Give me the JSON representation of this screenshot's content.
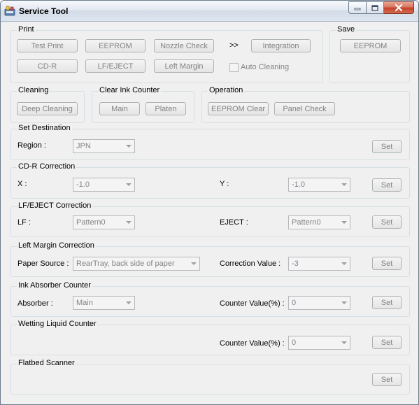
{
  "window": {
    "title": "Service Tool"
  },
  "print": {
    "label": "Print",
    "test_print": "Test Print",
    "eeprom": "EEPROM",
    "nozzle_check": "Nozzle Check",
    "more": ">>",
    "integration": "Integration",
    "cdr": "CD-R",
    "lf_eject": "LF/EJECT",
    "left_margin": "Left Margin",
    "auto_cleaning": "Auto Cleaning"
  },
  "save": {
    "label": "Save",
    "eeprom": "EEPROM"
  },
  "cleaning": {
    "label": "Cleaning",
    "deep": "Deep Cleaning"
  },
  "clear_ink": {
    "label": "Clear Ink Counter",
    "main": "Main",
    "platen": "Platen"
  },
  "operation": {
    "label": "Operation",
    "eeprom_clear": "EEPROM Clear",
    "panel_check": "Panel Check"
  },
  "set_destination": {
    "label": "Set Destination",
    "region_label": "Region :",
    "region_value": "JPN",
    "set": "Set"
  },
  "cdr_correction": {
    "label": "CD-R Correction",
    "x_label": "X :",
    "x_value": "-1.0",
    "y_label": "Y :",
    "y_value": "-1.0",
    "set": "Set"
  },
  "lf_correction": {
    "label": "LF/EJECT Correction",
    "lf_label": "LF :",
    "lf_value": "Pattern0",
    "eject_label": "EJECT :",
    "eject_value": "Pattern0",
    "set": "Set"
  },
  "left_margin_correction": {
    "label": "Left Margin Correction",
    "source_label": "Paper Source :",
    "source_value": "RearTray, back side of paper",
    "corr_label": "Correction Value :",
    "corr_value": "-3",
    "set": "Set"
  },
  "ink_absorber": {
    "label": "Ink Absorber Counter",
    "absorber_label": "Absorber :",
    "absorber_value": "Main",
    "counter_label": "Counter Value(%) :",
    "counter_value": "0",
    "set": "Set"
  },
  "wetting": {
    "label": "Wetting Liquid Counter",
    "counter_label": "Counter Value(%) :",
    "counter_value": "0",
    "set": "Set"
  },
  "flatbed": {
    "label": "Flatbed Scanner",
    "set": "Set"
  },
  "colors": {
    "disabled_text": "#838383",
    "group_border": "#d5dfe5",
    "close_red": "#c4412b"
  }
}
